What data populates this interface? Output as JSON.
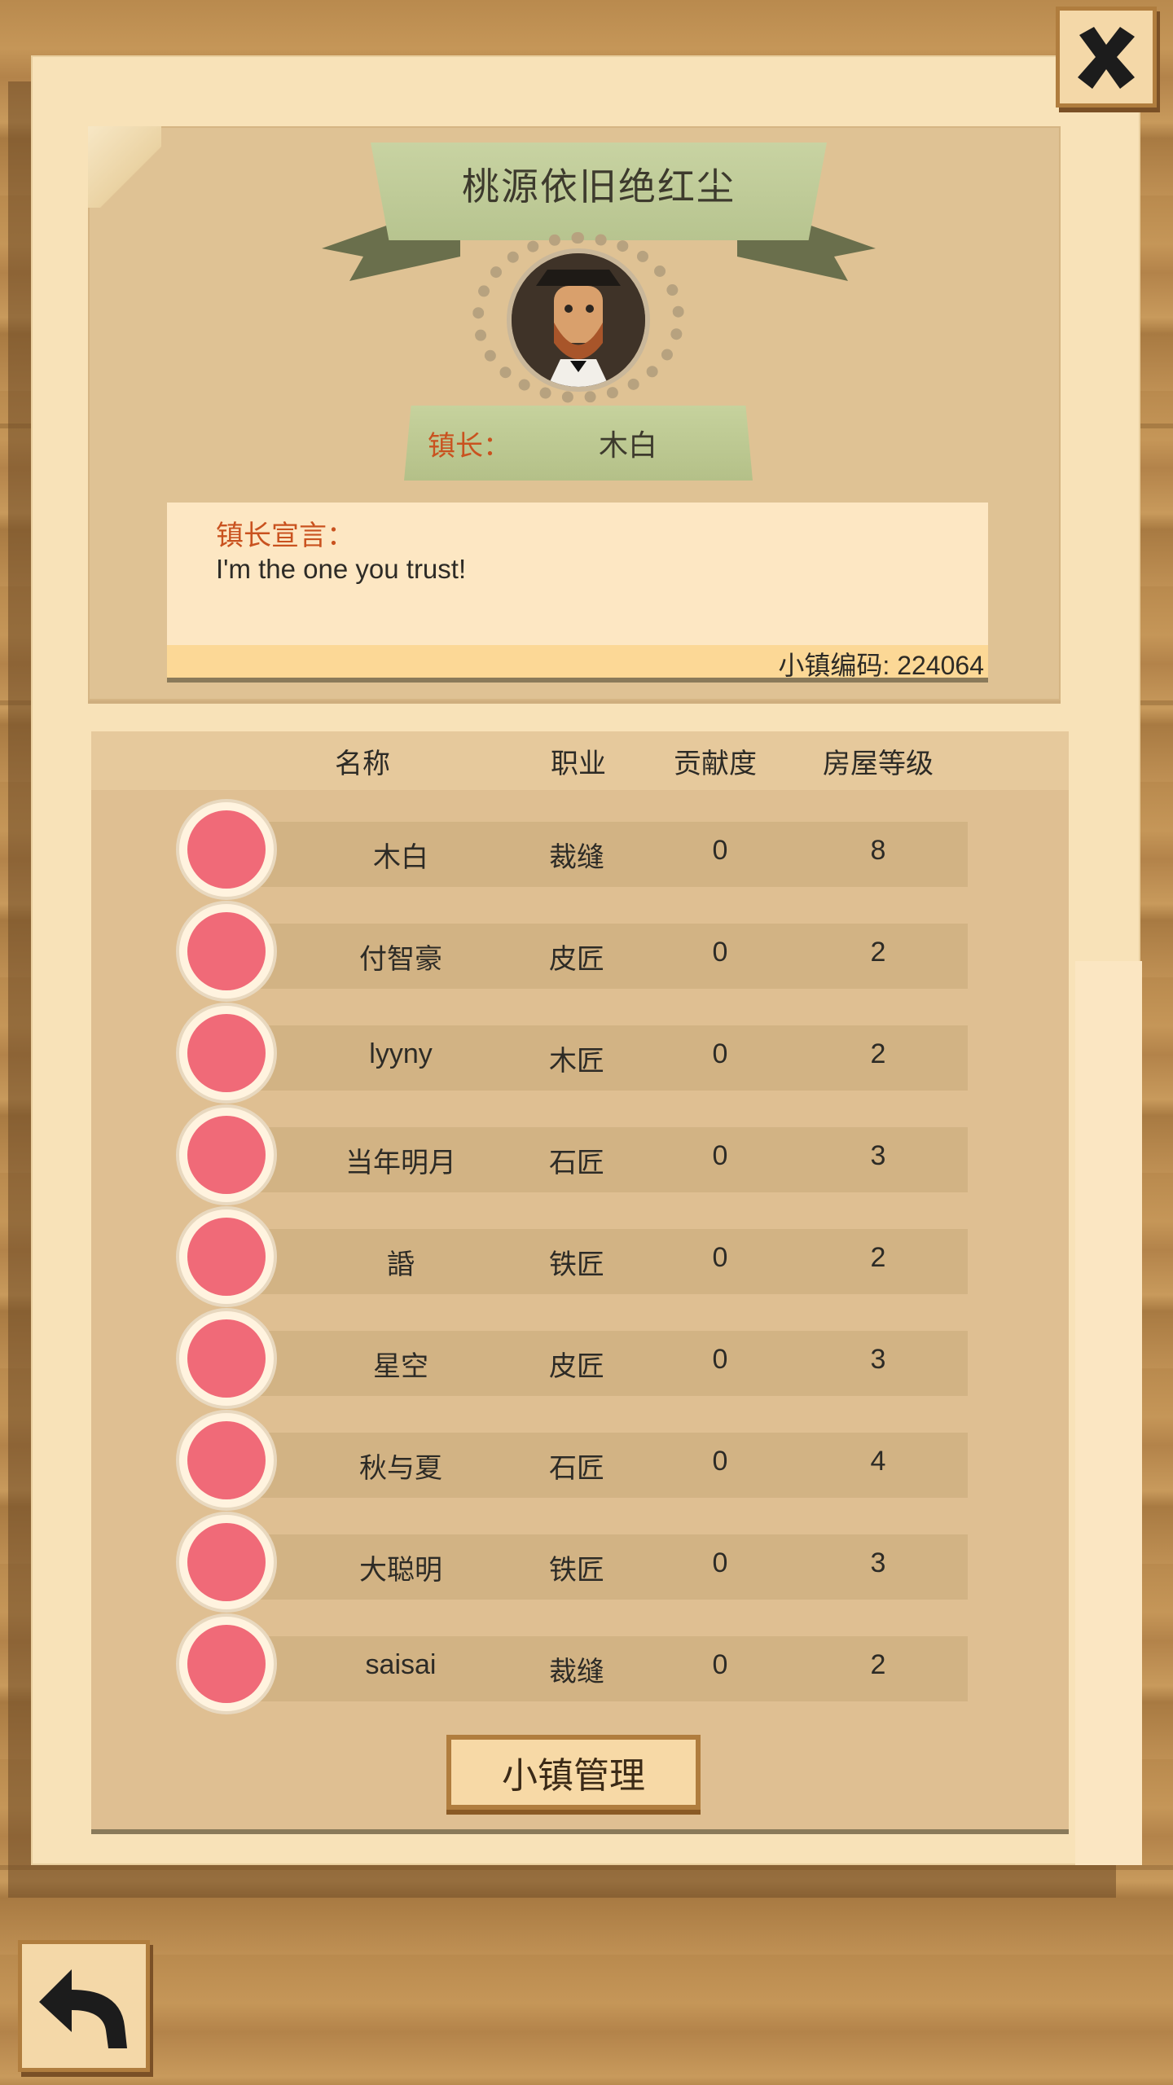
{
  "town": {
    "name": "桃源依旧绝红尘",
    "mayor_label": "镇长：",
    "mayor_name": "木白",
    "declaration_label": "镇长宣言：",
    "declaration_text": "I'm the one you trust!",
    "code_text": "小镇编码: 224064"
  },
  "table": {
    "headers": [
      "名称",
      "职业",
      "贡献度",
      "房屋等级"
    ],
    "rows": [
      {
        "name": "木白",
        "job": "裁缝",
        "contribution": "0",
        "house": "8"
      },
      {
        "name": "付智豪",
        "job": "皮匠",
        "contribution": "0",
        "house": "2"
      },
      {
        "name": "lyyny",
        "job": "木匠",
        "contribution": "0",
        "house": "2"
      },
      {
        "name": "当年明月",
        "job": "石匠",
        "contribution": "0",
        "house": "3"
      },
      {
        "name": "諙",
        "job": "铁匠",
        "contribution": "0",
        "house": "2"
      },
      {
        "name": "星空",
        "job": "皮匠",
        "contribution": "0",
        "house": "3"
      },
      {
        "name": "秋与夏",
        "job": "石匠",
        "contribution": "0",
        "house": "4"
      },
      {
        "name": "大聪明",
        "job": "铁匠",
        "contribution": "0",
        "house": "3"
      },
      {
        "name": "saisai",
        "job": "裁缝",
        "contribution": "0",
        "house": "2"
      }
    ]
  },
  "buttons": {
    "manage": "小镇管理"
  },
  "icons": {
    "close": "close-x-icon",
    "back": "back-arrow-icon"
  },
  "colors": {
    "accent_red": "#c9521f",
    "paper": "#f8e2b8",
    "panel": "#dfbf92",
    "ribbon": "#b7c48f"
  }
}
